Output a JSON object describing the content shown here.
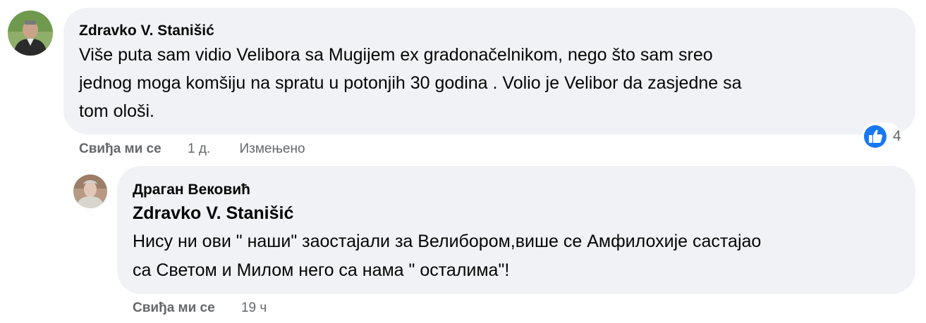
{
  "comments": [
    {
      "author": "Zdravko V. Stanišić",
      "text_lines": [
        "Više puta sam vidio Velibora sa Mugijem ex gradonačelnikom, nego što sam sreo",
        "jednog moga komšiju na spratu u potonjih 30 godina . Volio je Velibor da zasjedne sa",
        "tom ološi."
      ],
      "reaction_count": "4",
      "reaction_icon": "like-icon",
      "actions": {
        "like_label": "Свиђа ми се",
        "time": "1 д.",
        "edited": "Измењено"
      }
    }
  ],
  "replies": [
    {
      "author": "Драган Вековић",
      "mention": "Zdravko V. Stanišić",
      "text_lines": [
        "Нису ни ови \" наши\" заостајали за Велибором,више се Амфилохије састајао",
        "са Светом и Милом него са нама \" осталима\"!"
      ],
      "actions": {
        "like_label": "Свиђа ми се",
        "time": "19 ч"
      }
    }
  ],
  "colors": {
    "bubble": "#f0f2f5",
    "text": "#050505",
    "secondary": "#65676b",
    "like_blue": "#1877f2"
  }
}
